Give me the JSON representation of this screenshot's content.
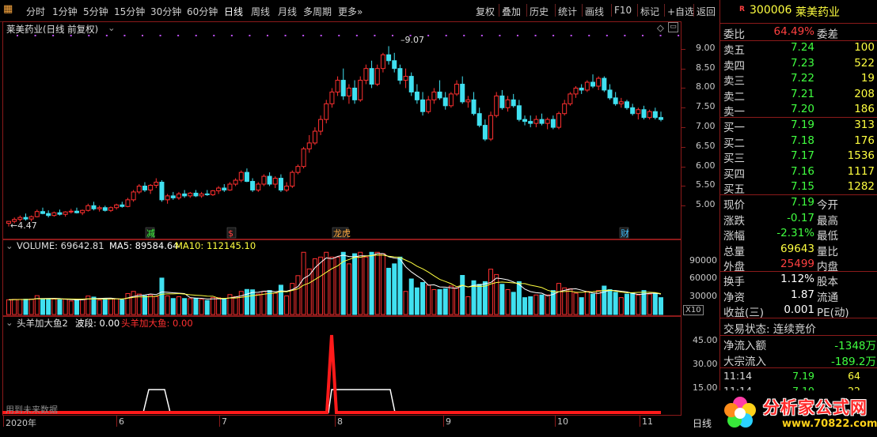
{
  "toolbar": {
    "left": [
      "分时",
      "1分钟",
      "5分钟",
      "15分钟",
      "30分钟",
      "60分钟",
      "日线",
      "周线",
      "月线",
      "多周期",
      "更多»"
    ],
    "right": [
      "复权",
      "叠加",
      "历史",
      "统计",
      "画线",
      "F10",
      "标记",
      "+自选",
      "返回"
    ],
    "active": "日线"
  },
  "main_panel": {
    "title": "莱美药业(日线 前复权)",
    "y_ticks": [
      "9.00",
      "8.50",
      "8.00",
      "7.50",
      "7.00",
      "6.50",
      "6.00",
      "5.50",
      "5.00"
    ],
    "high_label": "9.07",
    "low_label": "4.47",
    "markers": [
      {
        "text": "减",
        "color": "#40ff40"
      },
      {
        "text": "$",
        "color": "#ff4040"
      },
      {
        "text": "龙虎",
        "color": "#ffaa40"
      },
      {
        "text": "财",
        "color": "#40c0ff"
      }
    ]
  },
  "volume_panel": {
    "title_volume": "VOLUME: 69642.81",
    "title_ma5": "MA5: 89584.64",
    "title_ma10": "MA10: 112145.10",
    "y_ticks": [
      "90000",
      "60000",
      "30000"
    ],
    "unit": "X10"
  },
  "indicator_panel": {
    "title": "头羊加大鱼2",
    "wave": "波段: 0.00",
    "signal": "头羊加大鱼: 0.00",
    "y_ticks": [
      "45.00",
      "30.00",
      "15.00"
    ],
    "footnote": "用到未来数据"
  },
  "x_axis": {
    "labels": [
      "2020年",
      "6",
      "7",
      "8",
      "9",
      "10",
      "11"
    ],
    "period": "日线"
  },
  "stock": {
    "code": "300006",
    "name": "莱美药业",
    "badge": "R"
  },
  "order_book": {
    "weibi_label": "委比",
    "weibi_value": "64.49%",
    "weicha_label": "委差",
    "asks": [
      {
        "label": "卖五",
        "price": "7.24",
        "vol": "100"
      },
      {
        "label": "卖四",
        "price": "7.23",
        "vol": "522"
      },
      {
        "label": "卖三",
        "price": "7.22",
        "vol": "19"
      },
      {
        "label": "卖二",
        "price": "7.21",
        "vol": "208"
      },
      {
        "label": "卖一",
        "price": "7.20",
        "vol": "186"
      }
    ],
    "bids": [
      {
        "label": "买一",
        "price": "7.19",
        "vol": "313"
      },
      {
        "label": "买二",
        "price": "7.18",
        "vol": "176"
      },
      {
        "label": "买三",
        "price": "7.17",
        "vol": "1536"
      },
      {
        "label": "买四",
        "price": "7.16",
        "vol": "1117"
      },
      {
        "label": "买五",
        "price": "7.15",
        "vol": "1282"
      }
    ]
  },
  "quote": [
    {
      "label": "现价",
      "value": "7.19",
      "value_color": "green",
      "label2": "今开"
    },
    {
      "label": "涨跌",
      "value": "-0.17",
      "value_color": "green",
      "label2": "最高"
    },
    {
      "label": "涨幅",
      "value": "-2.31%",
      "value_color": "green",
      "label2": "最低"
    },
    {
      "label": "总量",
      "value": "69643",
      "value_color": "yellow",
      "label2": "量比"
    },
    {
      "label": "外盘",
      "value": "25499",
      "value_color": "red",
      "label2": "内盘"
    }
  ],
  "stats": [
    {
      "label": "换手",
      "value": "1.12%",
      "label2": "股本"
    },
    {
      "label": "净资",
      "value": "1.87",
      "label2": "流通"
    },
    {
      "label": "收益(三)",
      "value": "0.001",
      "label2": "PE(动)"
    }
  ],
  "trade_status": "交易状态: 连续竞价",
  "flows": [
    {
      "label": "净流入额",
      "value": "-1348万"
    },
    {
      "label": "大宗流入",
      "value": "-189.2万"
    }
  ],
  "ticks": [
    {
      "time": "11:14",
      "price": "7.19",
      "vol": "64"
    },
    {
      "time": "11:14",
      "price": "7.19",
      "vol": "22"
    }
  ],
  "watermark": {
    "title": "分析家公式网",
    "url": "www.70822.com"
  },
  "colors": {
    "up": "#ff3030",
    "down": "#40e0f0",
    "ma5": "#ffffff",
    "ma10": "#ffff40",
    "border": "#8b1a1a"
  },
  "chart_data": {
    "type": "candlestick",
    "note_range": [
      4.47,
      9.07
    ],
    "ylim": [
      4.3,
      9.3
    ],
    "candles": [
      [
        4.55,
        4.6,
        4.47,
        4.6
      ],
      [
        4.6,
        4.7,
        4.55,
        4.65
      ],
      [
        4.65,
        4.75,
        4.6,
        4.7
      ],
      [
        4.7,
        4.8,
        4.62,
        4.66
      ],
      [
        4.66,
        4.75,
        4.6,
        4.72
      ],
      [
        4.72,
        4.9,
        4.7,
        4.85
      ],
      [
        4.85,
        4.95,
        4.78,
        4.8
      ],
      [
        4.8,
        4.88,
        4.7,
        4.75
      ],
      [
        4.75,
        4.85,
        4.72,
        4.82
      ],
      [
        4.82,
        4.9,
        4.75,
        4.78
      ],
      [
        4.78,
        4.86,
        4.72,
        4.84
      ],
      [
        4.84,
        4.92,
        4.8,
        4.86
      ],
      [
        4.86,
        4.95,
        4.8,
        4.82
      ],
      [
        4.82,
        4.9,
        4.76,
        4.88
      ],
      [
        4.88,
        5.05,
        4.85,
        5.0
      ],
      [
        5.0,
        5.1,
        4.88,
        4.92
      ],
      [
        4.92,
        5.0,
        4.85,
        4.95
      ],
      [
        4.95,
        5.0,
        4.85,
        4.88
      ],
      [
        4.88,
        4.98,
        4.84,
        4.95
      ],
      [
        4.95,
        5.05,
        4.9,
        5.02
      ],
      [
        5.02,
        5.1,
        4.95,
        4.98
      ],
      [
        4.98,
        5.2,
        4.96,
        5.15
      ],
      [
        5.15,
        5.4,
        5.1,
        5.35
      ],
      [
        5.35,
        5.55,
        5.3,
        5.5
      ],
      [
        5.5,
        5.6,
        5.35,
        5.4
      ],
      [
        5.4,
        5.55,
        5.3,
        5.52
      ],
      [
        5.52,
        5.7,
        5.45,
        5.6
      ],
      [
        5.6,
        5.65,
        5.1,
        5.15
      ],
      [
        5.15,
        5.3,
        5.05,
        5.25
      ],
      [
        5.25,
        5.35,
        5.15,
        5.2
      ],
      [
        5.2,
        5.35,
        5.15,
        5.3
      ],
      [
        5.3,
        5.4,
        5.2,
        5.25
      ],
      [
        5.25,
        5.35,
        5.2,
        5.32
      ],
      [
        5.32,
        5.4,
        5.22,
        5.25
      ],
      [
        5.25,
        5.35,
        5.2,
        5.3
      ],
      [
        5.3,
        5.4,
        5.25,
        5.28
      ],
      [
        5.28,
        5.4,
        5.25,
        5.38
      ],
      [
        5.38,
        5.5,
        5.3,
        5.45
      ],
      [
        5.45,
        5.55,
        5.35,
        5.4
      ],
      [
        5.4,
        5.6,
        5.38,
        5.55
      ],
      [
        5.55,
        5.7,
        5.5,
        5.65
      ],
      [
        5.65,
        5.9,
        5.6,
        5.85
      ],
      [
        5.85,
        5.95,
        5.6,
        5.62
      ],
      [
        5.62,
        5.7,
        5.35,
        5.4
      ],
      [
        5.4,
        5.6,
        5.35,
        5.55
      ],
      [
        5.55,
        5.8,
        5.5,
        5.75
      ],
      [
        5.75,
        5.85,
        5.5,
        5.55
      ],
      [
        5.55,
        5.75,
        5.45,
        5.7
      ],
      [
        5.7,
        5.8,
        5.35,
        5.4
      ],
      [
        5.4,
        5.6,
        5.35,
        5.5
      ],
      [
        5.5,
        5.9,
        5.45,
        5.85
      ],
      [
        5.85,
        6.05,
        5.8,
        6.0
      ],
      [
        6.0,
        6.5,
        5.95,
        6.45
      ],
      [
        6.45,
        6.8,
        6.35,
        6.6
      ],
      [
        6.6,
        7.0,
        6.55,
        6.9
      ],
      [
        6.9,
        7.3,
        6.8,
        7.2
      ],
      [
        7.2,
        7.7,
        7.1,
        7.6
      ],
      [
        7.6,
        8.0,
        7.5,
        7.9
      ],
      [
        7.9,
        8.3,
        7.8,
        8.2
      ],
      [
        8.2,
        8.5,
        7.7,
        7.8
      ],
      [
        7.8,
        8.1,
        7.6,
        8.0
      ],
      [
        8.0,
        8.2,
        7.6,
        7.7
      ],
      [
        7.7,
        8.3,
        7.65,
        8.2
      ],
      [
        8.2,
        8.6,
        8.1,
        8.5
      ],
      [
        8.5,
        8.7,
        8.0,
        8.1
      ],
      [
        8.1,
        8.6,
        8.05,
        8.5
      ],
      [
        8.5,
        8.9,
        8.4,
        8.85
      ],
      [
        8.85,
        9.07,
        8.6,
        8.7
      ],
      [
        8.7,
        8.9,
        8.4,
        8.5
      ],
      [
        8.5,
        8.6,
        8.1,
        8.2
      ],
      [
        8.2,
        8.5,
        8.0,
        8.3
      ],
      [
        8.3,
        8.4,
        7.8,
        7.9
      ],
      [
        7.9,
        8.1,
        7.6,
        7.7
      ],
      [
        7.7,
        7.9,
        7.3,
        7.4
      ],
      [
        7.4,
        7.8,
        7.35,
        7.7
      ],
      [
        7.7,
        8.0,
        7.6,
        7.9
      ],
      [
        7.9,
        8.2,
        7.7,
        7.75
      ],
      [
        7.75,
        7.9,
        7.45,
        7.55
      ],
      [
        7.55,
        7.9,
        7.5,
        7.85
      ],
      [
        7.85,
        8.2,
        7.8,
        8.1
      ],
      [
        8.1,
        8.3,
        7.6,
        7.65
      ],
      [
        7.65,
        7.8,
        7.5,
        7.7
      ],
      [
        7.7,
        7.9,
        7.3,
        7.35
      ],
      [
        7.35,
        7.5,
        7.0,
        7.05
      ],
      [
        7.05,
        7.2,
        6.65,
        6.7
      ],
      [
        6.7,
        7.4,
        6.65,
        7.3
      ],
      [
        7.3,
        7.9,
        7.25,
        7.8
      ],
      [
        7.8,
        7.95,
        7.45,
        7.5
      ],
      [
        7.5,
        7.8,
        7.4,
        7.7
      ],
      [
        7.7,
        7.85,
        7.5,
        7.55
      ],
      [
        7.55,
        7.7,
        7.15,
        7.2
      ],
      [
        7.2,
        7.3,
        7.05,
        7.15
      ],
      [
        7.15,
        7.3,
        7.0,
        7.1
      ],
      [
        7.1,
        7.3,
        7.0,
        7.2
      ],
      [
        7.2,
        7.35,
        7.05,
        7.1
      ],
      [
        7.1,
        7.25,
        6.95,
        7.2
      ],
      [
        7.2,
        7.3,
        6.95,
        7.0
      ],
      [
        7.0,
        7.4,
        6.95,
        7.35
      ],
      [
        7.35,
        7.7,
        7.3,
        7.6
      ],
      [
        7.6,
        7.9,
        7.55,
        7.85
      ],
      [
        7.85,
        8.05,
        7.75,
        8.0
      ],
      [
        8.0,
        8.1,
        7.85,
        7.95
      ],
      [
        7.95,
        8.2,
        7.9,
        8.15
      ],
      [
        8.15,
        8.35,
        8.0,
        8.05
      ],
      [
        8.05,
        8.3,
        7.95,
        8.25
      ],
      [
        8.25,
        8.3,
        7.9,
        7.95
      ],
      [
        7.95,
        8.1,
        7.7,
        7.75
      ],
      [
        7.75,
        7.9,
        7.55,
        7.6
      ],
      [
        7.6,
        7.75,
        7.5,
        7.65
      ],
      [
        7.65,
        7.7,
        7.45,
        7.5
      ],
      [
        7.5,
        7.6,
        7.3,
        7.35
      ],
      [
        7.35,
        7.5,
        7.2,
        7.45
      ],
      [
        7.45,
        7.55,
        7.2,
        7.25
      ],
      [
        7.25,
        7.45,
        7.2,
        7.4
      ],
      [
        7.4,
        7.5,
        7.2,
        7.25
      ],
      [
        7.25,
        7.4,
        7.15,
        7.2
      ]
    ]
  }
}
